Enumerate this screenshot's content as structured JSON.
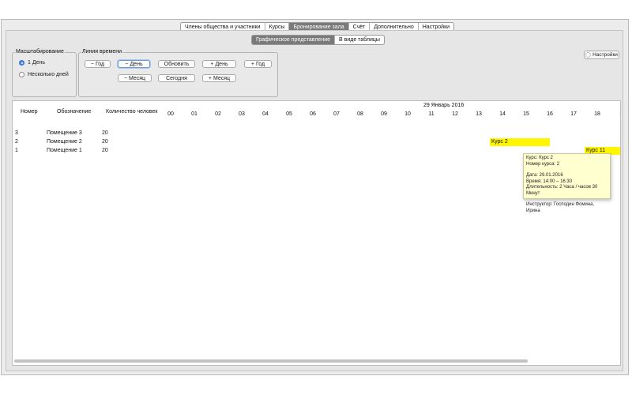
{
  "tabs": [
    "Члены общества и участники",
    "Курсы",
    "Бронирование зала",
    "Счёт",
    "Дополнительно",
    "Настройки"
  ],
  "active_tab": "Бронирование зала",
  "subtabs": [
    "Графическое представление",
    "В виде таблицы"
  ],
  "active_subtab": "Графическое представление",
  "scale": {
    "title": "Масштабирование",
    "option_1": "1 День",
    "option_2": "Несколько дней"
  },
  "timeline": {
    "title": "Линия времени",
    "btn_year_minus": "− Год",
    "btn_day_minus": "− День",
    "btn_refresh": "Обновить",
    "btn_day_plus": "+ День",
    "btn_year_plus": "+ Год",
    "btn_month_minus": "− Месяц",
    "btn_today": "Сегодня",
    "btn_month_plus": "+ Месяц"
  },
  "settings_button": "Настройки",
  "table": {
    "col_number": "Номер",
    "col_name": "Обозначение",
    "col_capacity": "Количество человек",
    "date": "29 Январь 2016",
    "hours": [
      "00",
      "01",
      "02",
      "03",
      "04",
      "05",
      "06",
      "07",
      "08",
      "09",
      "10",
      "11",
      "12",
      "13",
      "14",
      "15",
      "16",
      "17",
      "18",
      "1"
    ],
    "rows": [
      {
        "number": "3",
        "name": "Помещение 3",
        "capacity": "20"
      },
      {
        "number": "2",
        "name": "Помещение 2",
        "capacity": "20"
      },
      {
        "number": "1",
        "name": "Помещение 1",
        "capacity": "20"
      }
    ]
  },
  "bookings": [
    {
      "label": "Курс 2",
      "color": "#fff600"
    },
    {
      "label": "Курс 11",
      "color": "#fff600"
    }
  ],
  "tooltip": {
    "line1": "Курс: Курс 2",
    "line2": "Номер курса: 2",
    "line3": "Дата: 29.01.2016",
    "line4": "Время: 14:00 – 16:30",
    "line5": "Длительность: 2 Часа / часов 30 Минут",
    "line6": "Инструктор: Господин Фомина, Ирина"
  }
}
